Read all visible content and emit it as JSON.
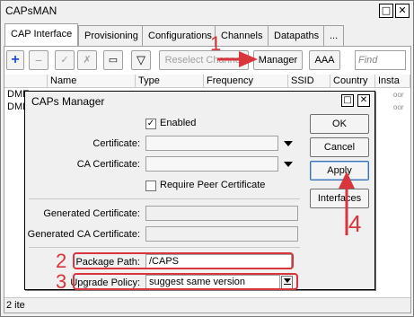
{
  "window": {
    "title": "CAPsMAN",
    "minimize_glyph": "□",
    "close_glyph": "✕"
  },
  "tabs": [
    {
      "label": "CAP Interface"
    },
    {
      "label": "Provisioning"
    },
    {
      "label": "Configurations"
    },
    {
      "label": "Channels"
    },
    {
      "label": "Datapaths"
    },
    {
      "label": "..."
    }
  ],
  "toolbar": {
    "add_glyph": "+",
    "remove_glyph": "−",
    "enable_glyph": "✓",
    "disable_glyph": "✗",
    "comment_glyph": "▭",
    "filter_glyph": "▽",
    "reselect_label": "Reselect Channel",
    "manager_label": "Manager",
    "aaa_label": "AAA",
    "find_placeholder": "Find"
  },
  "table": {
    "columns": [
      "Name",
      "Type",
      "Frequency",
      "SSID",
      "Country",
      "Insta"
    ],
    "rows": [
      {
        "name": "DME",
        "tail": "oor"
      },
      {
        "name": "DME",
        "tail": "oor"
      }
    ]
  },
  "status_bar": {
    "text": "2 ite"
  },
  "dialog": {
    "title": "CAPs Manager",
    "maximize_glyph": "□",
    "close_glyph": "✕",
    "enabled_label": "Enabled",
    "enabled_checked": "✓",
    "certificate_label": "Certificate:",
    "ca_certificate_label": "CA Certificate:",
    "require_peer_label": "Require Peer Certificate",
    "generated_certificate_label": "Generated Certificate:",
    "generated_ca_certificate_label": "Generated CA Certificate:",
    "package_path_label": "Package Path:",
    "package_path_value": "/CAPS",
    "upgrade_policy_label": "Upgrade Policy:",
    "upgrade_policy_value": "suggest same version",
    "buttons": {
      "ok": "OK",
      "cancel": "Cancel",
      "apply": "Apply",
      "interfaces": "Interfaces"
    }
  },
  "annotations": {
    "step1": "1",
    "step2": "2",
    "step3": "3",
    "step4": "4",
    "color": "#d9353c"
  }
}
